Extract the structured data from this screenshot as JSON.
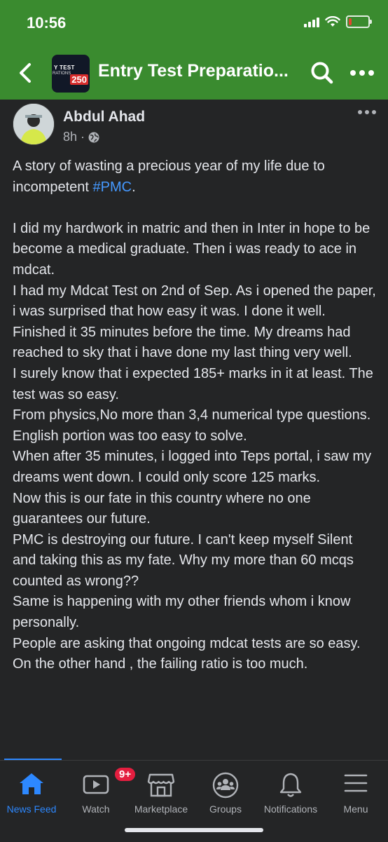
{
  "status": {
    "time": "10:56"
  },
  "header": {
    "group_title": "Entry Test Preparatio...",
    "thumb_text_1": "Y TEST",
    "thumb_text_2": "RATIONS",
    "thumb_number": "250"
  },
  "post": {
    "author": "Abdul Ahad",
    "time": "8h",
    "separator": "·",
    "paragraphs": [
      {
        "before": "A story of wasting a precious year of my life due to incompetent ",
        "hashtag": "#PMC",
        "after": "."
      },
      {
        "gap": true
      },
      {
        "text": "I did my hardwork in matric and then in Inter in hope to be become a medical graduate. Then i was ready to ace in mdcat."
      },
      {
        "text": "I had my Mdcat Test on 2nd of Sep. As i opened the paper, i was surprised that how easy it was. I done it well. Finished it 35 minutes before the time. My dreams had reached to  sky that i have done my last thing very well."
      },
      {
        "text": "I surely know that i expected 185+ marks in it at least. The test was so easy."
      },
      {
        "text": "From physics,No more than 3,4 numerical type questions."
      },
      {
        "text": "English portion was too easy to solve."
      },
      {
        "text": "When after 35 minutes, i logged into Teps portal, i saw my dreams went down. I could only score 125 marks."
      },
      {
        "text": "Now this is our fate in this country where no one guarantees our future."
      },
      {
        "text": "PMC is destroying our future. I can't keep myself Silent and taking this as my fate. Why my more than 60 mcqs counted as wrong??"
      },
      {
        "text": "Same is happening with my other friends whom i know personally."
      },
      {
        "text": "People are asking that ongoing mdcat tests are so easy. On the other hand , the failing ratio is too much."
      }
    ]
  },
  "tabbar": {
    "tabs": [
      {
        "label": "News Feed",
        "icon": "home-icon",
        "active": true
      },
      {
        "label": "Watch",
        "icon": "watch-icon",
        "badge": "9+"
      },
      {
        "label": "Marketplace",
        "icon": "marketplace-icon"
      },
      {
        "label": "Groups",
        "icon": "groups-icon"
      },
      {
        "label": "Notifications",
        "icon": "bell-icon"
      },
      {
        "label": "Menu",
        "icon": "menu-icon"
      }
    ]
  },
  "colors": {
    "header_green": "#3a8b2f",
    "background": "#242526",
    "link_blue": "#4599ff",
    "active_tab": "#2d88ff",
    "badge_red": "#e41e3f"
  }
}
